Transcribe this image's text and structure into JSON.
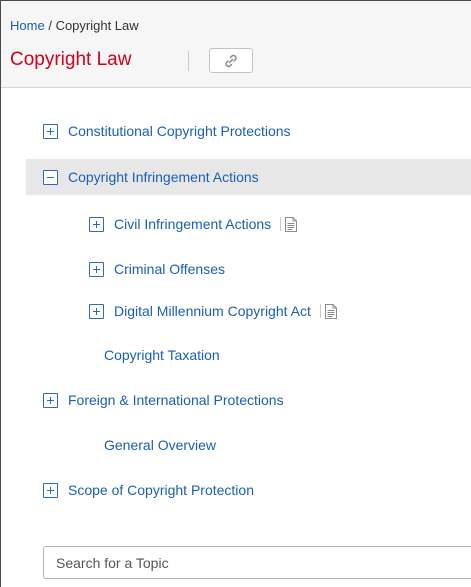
{
  "breadcrumb": {
    "home": "Home",
    "separator": "/",
    "current": "Copyright Law"
  },
  "title": "Copyright Law",
  "tree": {
    "items": [
      {
        "label": "Constitutional Copyright Protections",
        "toggle": "plus"
      },
      {
        "label": "Copyright Infringement Actions",
        "toggle": "minus",
        "highlighted": true
      },
      {
        "label": "Civil Infringement Actions",
        "toggle": "plus",
        "has_document": true
      },
      {
        "label": "Criminal Offenses",
        "toggle": "plus"
      },
      {
        "label": "Digital Millennium Copyright Act",
        "toggle": "plus",
        "has_document": true
      },
      {
        "label": "Copyright Taxation"
      },
      {
        "label": "Foreign & International Protections",
        "toggle": "plus"
      },
      {
        "label": "General Overview"
      },
      {
        "label": "Scope of Copyright Protection",
        "toggle": "plus"
      }
    ]
  },
  "search": {
    "placeholder": "Search for a Topic"
  },
  "colors": {
    "title": "#d0021b",
    "link": "#1a5fb4",
    "highlight": "#e7e7e7"
  },
  "icons": {
    "link_button": "link-icon",
    "document": "document-icon"
  }
}
